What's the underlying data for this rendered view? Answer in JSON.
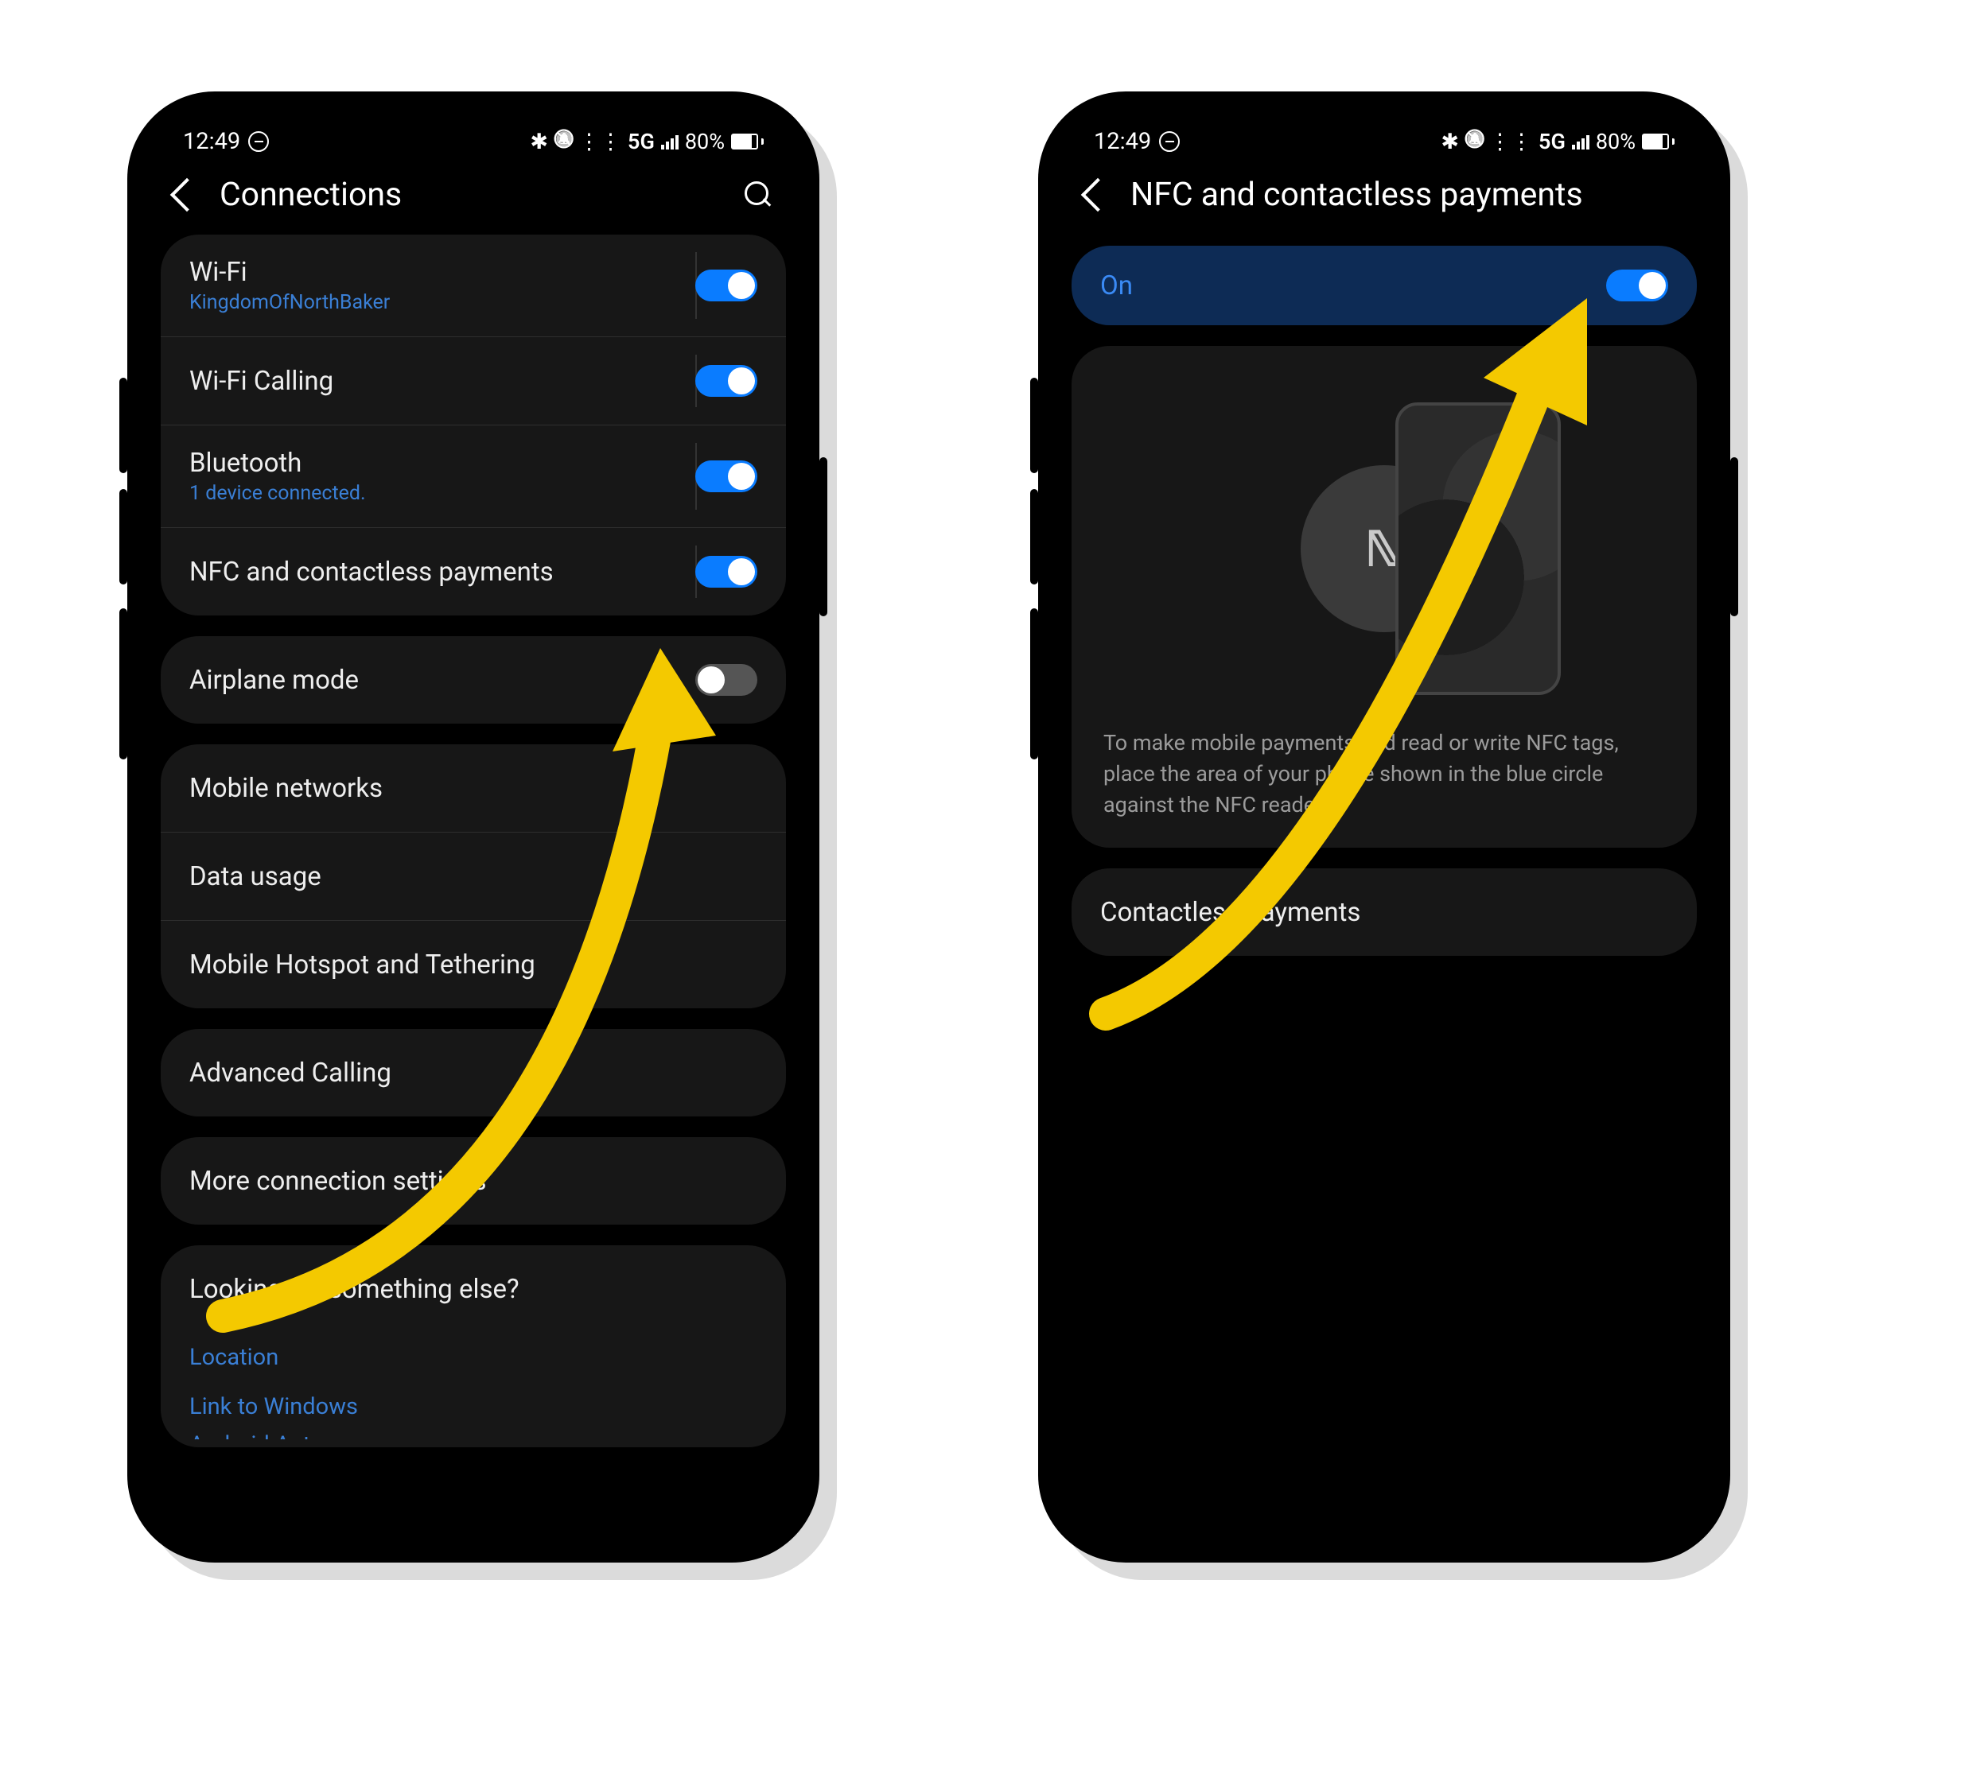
{
  "status": {
    "time": "12:49",
    "network_label": "5G",
    "battery_pct": "80%"
  },
  "left": {
    "title": "Connections",
    "rows_group1": [
      {
        "label": "Wi-Fi",
        "sub": "KingdomOfNorthBaker",
        "toggle": "on",
        "divider": true
      },
      {
        "label": "Wi-Fi Calling",
        "sub": "",
        "toggle": "on",
        "divider": true
      },
      {
        "label": "Bluetooth",
        "sub": "1 device connected.",
        "toggle": "on",
        "divider": true
      },
      {
        "label": "NFC and contactless payments",
        "sub": "",
        "toggle": "on",
        "divider": true
      }
    ],
    "airplane": {
      "label": "Airplane mode",
      "toggle": "off"
    },
    "rows_group2": [
      {
        "label": "Mobile networks"
      },
      {
        "label": "Data usage"
      },
      {
        "label": "Mobile Hotspot and Tethering"
      }
    ],
    "adv": {
      "label": "Advanced Calling"
    },
    "more": {
      "label": "More connection settings"
    },
    "footer": {
      "title": "Looking for something else?",
      "links": [
        "Location",
        "Link to Windows",
        "Android Auto"
      ]
    }
  },
  "right": {
    "title": "NFC and contactless payments",
    "on_label": "On",
    "on_toggle": "on",
    "nfc_symbol": "ℕ",
    "info_text": "To make mobile payments and read or write NFC tags, place the area of your phone shown in the blue circle against the NFC reader.",
    "contactless": {
      "label": "Contactless payments"
    }
  },
  "colors": {
    "accent": "#3a7fd5",
    "arrow": "#f4c900"
  }
}
